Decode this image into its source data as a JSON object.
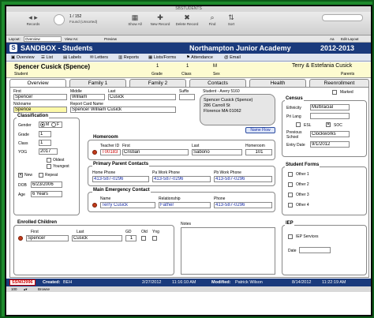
{
  "window": {
    "title": "SBSTUDENTS"
  },
  "toolbar": {
    "records_label": "Records",
    "record_position": "1 / 152",
    "found_label": "Found (Unsorted)",
    "show_all": "Show All",
    "new_record": "New Record",
    "delete_record": "Delete Record",
    "find": "Find",
    "sort": "Sort"
  },
  "layoutbar": {
    "layout_label": "Layout:",
    "layout_value": "Overview",
    "view_as": "View As:",
    "preview": "Preview",
    "aa": "Aa",
    "edit_layout": "Edit Layout"
  },
  "header": {
    "app": "SANDBOX - Students",
    "school": "Northampton Junior Academy",
    "year": "2012-2013"
  },
  "nav": {
    "overview": "Overview",
    "list": "List",
    "labels": "Labels",
    "letters": "Letters",
    "reports": "Reports",
    "lists_forms": "Lists/Forms",
    "attendance": "Attendance",
    "email": "Email"
  },
  "student": {
    "name": "Spencer Cusick (Spence)",
    "name_label": "Student",
    "grade": "1",
    "grade_label": "Grade",
    "class": "1",
    "class_label": "Class",
    "sex": "M",
    "sex_label": "Sex",
    "parents": "Terry & Estefania Cusick",
    "parents_label": "Parents"
  },
  "tabs": [
    "Overview",
    "Family 1",
    "Family 2",
    "Contacts",
    "Health",
    "Reenrollment"
  ],
  "names": {
    "first_label": "First",
    "middle_label": "Middle",
    "last_label": "Last",
    "suffix_label": "Suffix",
    "first": "Spencer",
    "middle": "William",
    "last": "Cusick",
    "suffix": "",
    "nickname_label": "Nickname",
    "nickname": "Spence",
    "report_card_label": "Report Card Name",
    "report_card": "Spencer William Cusick"
  },
  "address": {
    "label": "Student - Avery 5160",
    "line1": "Spencer Cusick (Spence)",
    "line2": "286 Carroll St",
    "line3": "Florence MA 01062",
    "name_flow": "Name Flow"
  },
  "marked": {
    "label": "Marked"
  },
  "census": {
    "title": "Census",
    "ethnicity_label": "Ethnicity",
    "ethnicity": "Multiracial",
    "pri_lang_label": "Pri Lang",
    "pri_lang": "",
    "esl_label": "ESL",
    "soc_label": "SOC",
    "prev_school_label": "Previous School",
    "prev_school": "Clockworks",
    "entry_date_label": "Entry Date",
    "entry_date": "9/1/2012"
  },
  "classification": {
    "title": "Classification",
    "gender_label": "Gender",
    "m": "M",
    "f": "F",
    "grade_label": "Grade",
    "grade": "1",
    "class_label": "Class",
    "class": "1",
    "yog_label": "YOG",
    "yog": "2017",
    "oldest": "Oldest",
    "youngest": "Youngest",
    "new": "New",
    "repeat": "Repeat",
    "dob_label": "DOB",
    "dob": "6/23/2006",
    "age_label": "Age",
    "age": "6 Years"
  },
  "homeroom": {
    "title": "Homeroom",
    "teacher_id_label": "Teacher ID",
    "teacher_id": "T00183",
    "first_label": "First",
    "first": "Cristian",
    "last_label": "Last",
    "last": "Saborio",
    "homeroom_label": "Homeroom",
    "homeroom": "101"
  },
  "primary_parent": {
    "title": "Primary Parent Contacts",
    "home_label": "Home Phone",
    "home": "413-587-0296",
    "pa_work_label": "Pa Work Phone",
    "pa_work": "413-587-0296",
    "pb_work_label": "Pb Work Phone",
    "pb_work": "413-587-0296"
  },
  "emergency": {
    "title": "Main Emergency Contact",
    "name_label": "Name",
    "name": "Terry Cusick",
    "relationship_label": "Relationship",
    "relationship": "Father",
    "phone_label": "Phone",
    "phone": "413-587-0296"
  },
  "student_forms": {
    "title": "Student Forms",
    "items": [
      "Other 1",
      "Other 2",
      "Other 3",
      "Other 4"
    ]
  },
  "iep": {
    "title": "IEP",
    "services": "IEP Services",
    "date_label": "Date"
  },
  "enrolled": {
    "title": "Enrolled Children",
    "first_label": "First",
    "last_label": "Last",
    "gd_label": "GD",
    "old_label": "Old",
    "yng_label": "Yng",
    "rows": [
      {
        "first": "Spencer",
        "last": "Cusick",
        "gd": "1"
      }
    ]
  },
  "notes": {
    "label": "Notes"
  },
  "footer": {
    "id": "SSN02996",
    "created_label": "Created:",
    "created_by": "BEH",
    "created_date": "2/27/2012",
    "created_time": "11:16:10 AM",
    "modified_label": "Modified:",
    "modified_by": "Patrick Wilson",
    "modified_date": "8/14/2012",
    "modified_time": "11:22:19 AM"
  },
  "status": {
    "zoom": "100",
    "mode": "Browse"
  }
}
